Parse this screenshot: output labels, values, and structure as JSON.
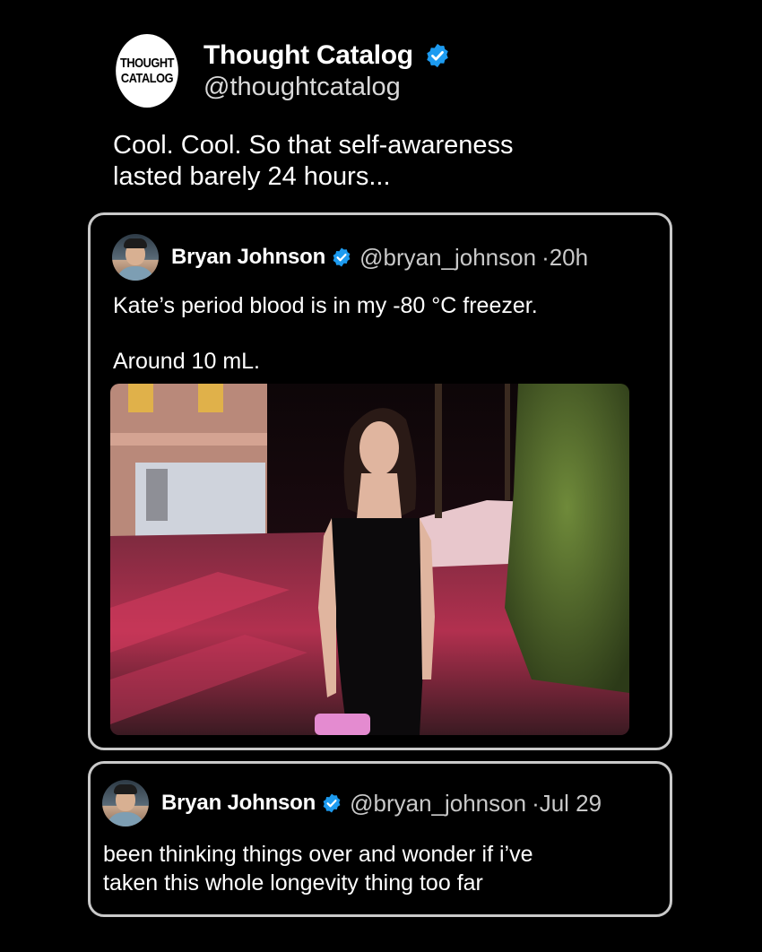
{
  "post": {
    "logo_line1": "THOUGHT",
    "logo_line2": "CATALOG",
    "display_name": "Thought Catalog",
    "handle": "@thoughtcatalog",
    "text_line1": "Cool. Cool. So that self-awareness",
    "text_line2": "lasted barely 24 hours..."
  },
  "quote1": {
    "name": "Bryan Johnson",
    "handle": "@bryan_johnson",
    "time": "·20h",
    "text_line1": "Kate’s period blood is in my -80 °C freezer.",
    "text_line2": "Around 10 mL."
  },
  "quote2": {
    "name": "Bryan Johnson",
    "handle": "@bryan_johnson",
    "time": "·Jul 29",
    "text_line1": "been thinking things over and wonder if i’ve",
    "text_line2": "taken this whole longevity thing too far"
  },
  "colors": {
    "background": "#000000",
    "verified": "#1d9bf0",
    "card_border": "#c9c9c9"
  },
  "icons": [
    "verified-badge-icon",
    "avatar"
  ]
}
